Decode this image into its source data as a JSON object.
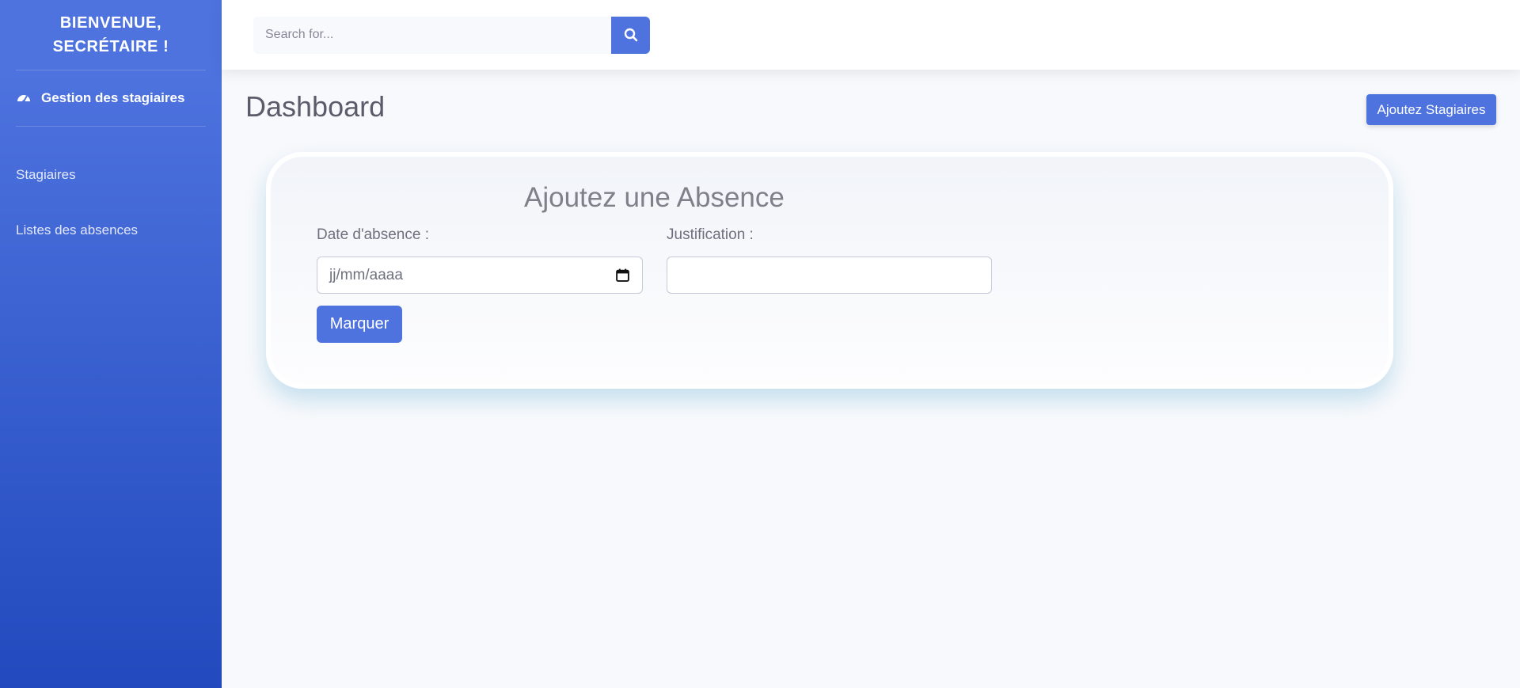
{
  "sidebar": {
    "brand": "BIENVENUE, SECRÉTAIRE !",
    "main_item": {
      "label": "Gestion des stagiaires",
      "icon": "tachometer-icon"
    },
    "items": [
      {
        "label": "Stagiaires"
      },
      {
        "label": "Listes des absences"
      }
    ]
  },
  "topbar": {
    "search_placeholder": "Search for...",
    "search_icon": "search-icon"
  },
  "page": {
    "title": "Dashboard",
    "add_button": "Ajoutez Stagiaires"
  },
  "form": {
    "title": "Ajoutez une Absence",
    "date_label": "Date d'absence :",
    "date_value": "jj/mm/aaaa",
    "justification_label": "Justification :",
    "justification_value": "",
    "submit_label": "Marquer"
  },
  "colors": {
    "primary": "#4e73df",
    "sidebar_gradient_end": "#224abe",
    "background": "#f8f9fc",
    "text_dark": "#5a5c69"
  }
}
